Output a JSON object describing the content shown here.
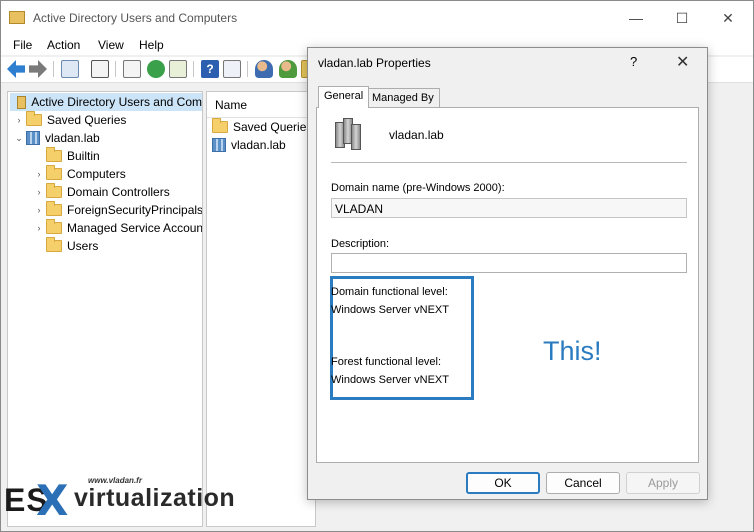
{
  "app": {
    "title": "Active Directory Users and Computers",
    "window_controls": {
      "minimize": "—",
      "maximize": "☐",
      "close": "✕"
    }
  },
  "menubar": [
    "File",
    "Action",
    "View",
    "Help"
  ],
  "tree": {
    "root": "Active Directory Users and Com",
    "items": [
      {
        "label": "Saved Queries",
        "expander": "›"
      },
      {
        "label": "vladan.lab",
        "expander": "⌄"
      },
      {
        "label": "Builtin",
        "expander": ""
      },
      {
        "label": "Computers",
        "expander": "›"
      },
      {
        "label": "Domain Controllers",
        "expander": "›"
      },
      {
        "label": "ForeignSecurityPrincipals",
        "expander": "›"
      },
      {
        "label": "Managed Service Accoun",
        "expander": "›"
      },
      {
        "label": "Users",
        "expander": ""
      }
    ]
  },
  "list": {
    "column_header": "Name",
    "rows": [
      "Saved Queries",
      "vladan.lab"
    ]
  },
  "dialog": {
    "title": "vladan.lab Properties",
    "help": "?",
    "close": "✕",
    "tabs": [
      "General",
      "Managed By"
    ],
    "active_tab": "General",
    "object_name": "vladan.lab",
    "domain_name_label": "Domain name (pre-Windows 2000):",
    "domain_name_value": "VLADAN",
    "description_label": "Description:",
    "description_value": "",
    "domain_level_label": "Domain functional level:",
    "domain_level_value": "Windows Server vNEXT",
    "forest_level_label": "Forest functional level:",
    "forest_level_value": "Windows Server vNEXT",
    "annotation": "This!",
    "buttons": {
      "ok": "OK",
      "cancel": "Cancel",
      "apply": "Apply"
    }
  },
  "watermark": {
    "url": "www.vladan.fr",
    "es": "ES",
    "x": "X",
    "virtualization": "virtualization"
  },
  "colors": {
    "accent": "#2a7bbf",
    "selection": "#cce4f7"
  }
}
